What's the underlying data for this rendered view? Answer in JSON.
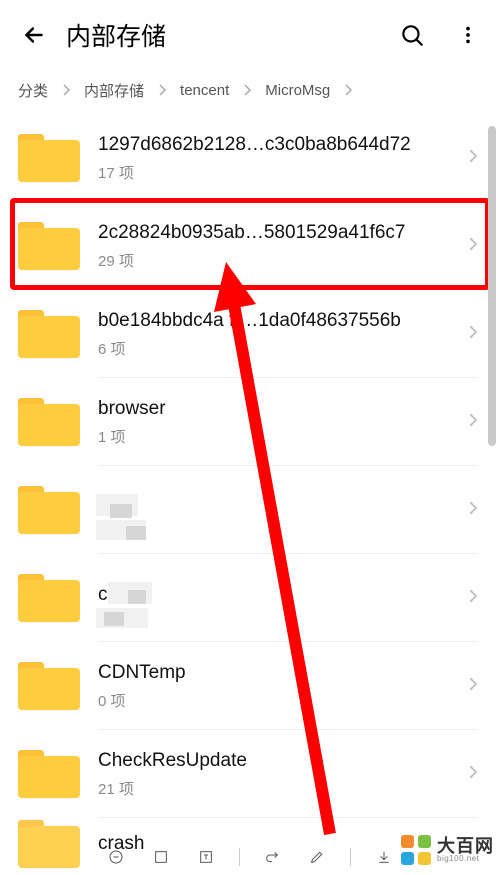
{
  "header": {
    "title": "内部存储"
  },
  "breadcrumb": [
    "分类",
    "内部存储",
    "tencent",
    "MicroMsg"
  ],
  "items": [
    {
      "name": "1297d6862b2128…c3c0ba8b644d72",
      "sub": "17 项"
    },
    {
      "name": "2c28824b0935ab…5801529a41f6c7",
      "sub": "29 项",
      "highlight": true
    },
    {
      "name": "b0e184bbdc4a  ff…1da0f48637556b",
      "sub": "6 项"
    },
    {
      "name": "browser",
      "sub": "1 项"
    },
    {
      "name": "     he",
      "sub": " ",
      "obscured": true
    },
    {
      "name": "c    ",
      "sub": " ",
      "obscured": true
    },
    {
      "name": "CDNTemp",
      "sub": "0 项"
    },
    {
      "name": "CheckResUpdate",
      "sub": "21 项"
    },
    {
      "name": "crash",
      "sub": ""
    }
  ],
  "watermark": {
    "cn": "大百网",
    "en": "big100.net"
  },
  "colors": {
    "highlight": "#ff0000",
    "folder": "#ffcb3f"
  }
}
